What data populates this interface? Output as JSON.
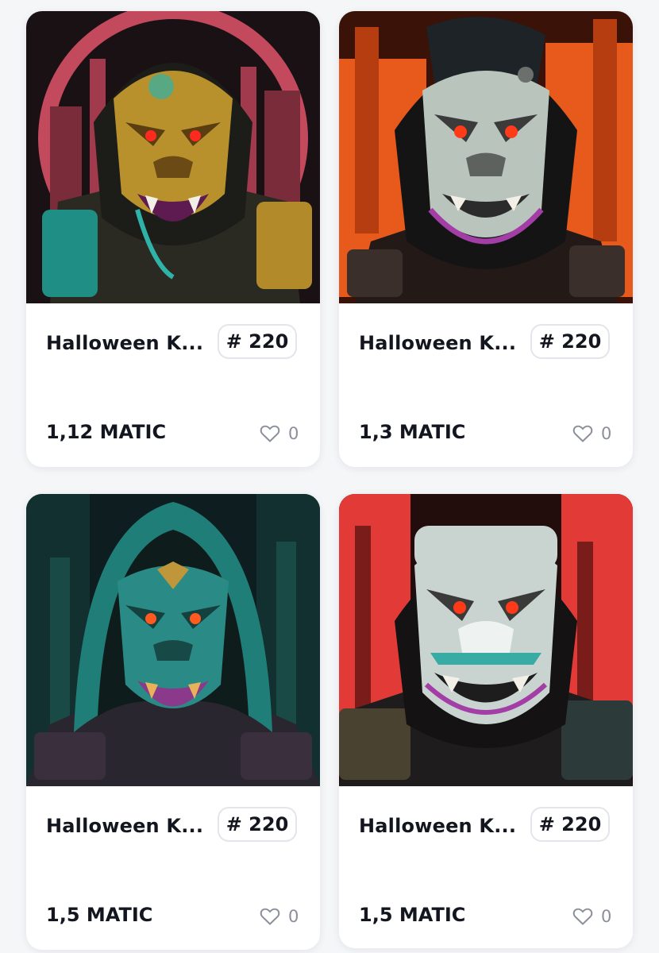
{
  "cards": [
    {
      "title": "Halloween K...",
      "badge": "# 220",
      "price": "1,12 MATIC",
      "likes": "0",
      "art": {
        "bg": "#1a1114",
        "accent": "#e2546a",
        "face": "#b8912c",
        "eyes": "#ff2a1f",
        "trim": "#2fb2a8"
      }
    },
    {
      "title": "Halloween K...",
      "badge": "# 220",
      "price": "1,3 MATIC",
      "likes": "0",
      "art": {
        "bg": "#3a1208",
        "accent": "#e85a1c",
        "face": "#b9c4bd",
        "eyes": "#ff3b1a",
        "trim": "#a43ea7"
      }
    },
    {
      "title": "Halloween K...",
      "badge": "# 220",
      "price": "1,5 MATIC",
      "likes": "0",
      "art": {
        "bg": "#0e1d1f",
        "accent": "#1f7f78",
        "face": "#2a8b86",
        "eyes": "#ff5a1f",
        "trim": "#8b3a8b"
      }
    },
    {
      "title": "Halloween K...",
      "badge": "# 220",
      "price": "1,5 MATIC",
      "likes": "0",
      "art": {
        "bg": "#220d0c",
        "accent": "#e23a36",
        "face": "#c9d3d0",
        "eyes": "#ff3a1a",
        "trim": "#1fa39c"
      }
    }
  ],
  "colors": {
    "page_bg": "#f5f6f8",
    "card_bg": "#ffffff",
    "text": "#14161f",
    "muted": "#8a8f9a",
    "badge_border": "#e3e5ea"
  },
  "icons": {
    "like": "heart-outline-icon"
  }
}
